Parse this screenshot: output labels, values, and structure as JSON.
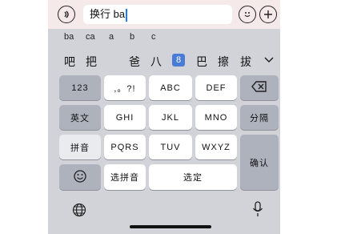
{
  "input": {
    "text": "换行 ba"
  },
  "pinyin_suggestions": [
    "ba",
    "ca",
    "a",
    "b",
    "c"
  ],
  "candidates": [
    "吧",
    "把",
    "爸",
    "八",
    "8",
    "巴",
    "擦",
    "拔"
  ],
  "keys": {
    "row1": [
      "123",
      ",。?!",
      "ABC",
      "DEF"
    ],
    "row2": [
      "英文",
      "GHI",
      "JKL",
      "MNO",
      "分隔"
    ],
    "row3": [
      "拼音",
      "PQRS",
      "TUV",
      "WXYZ",
      "确认"
    ],
    "row4": [
      "选拼音",
      "选定"
    ]
  },
  "icons": {
    "voice_left": "sound-icon",
    "emoji": "emoji-icon",
    "add": "plus-icon",
    "backspace": "backspace-icon",
    "expand": "chevron-down-icon",
    "globe": "globe-icon",
    "mic": "microphone-icon"
  },
  "colors": {
    "topbar_bg": "#f5e9ea",
    "keyboard_bg": "#d1d3d9",
    "dark_key": "#aeb2bd",
    "highlight": "#4a7bd6"
  }
}
